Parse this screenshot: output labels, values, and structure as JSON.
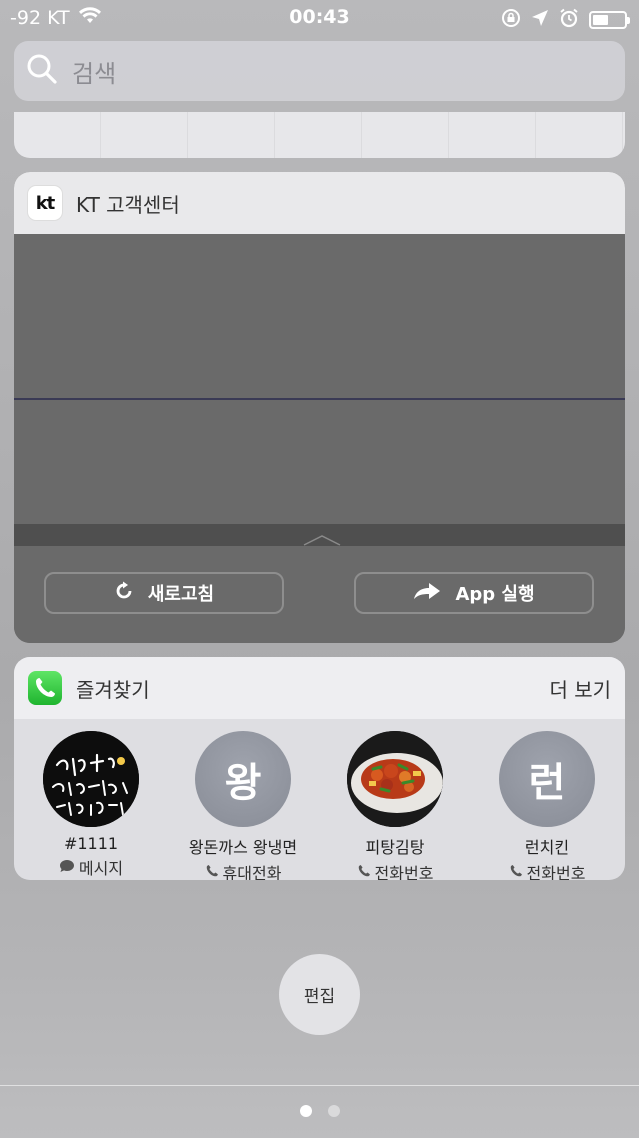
{
  "status_bar": {
    "carrier": "-92 KT",
    "time": "00:43",
    "battery_level": 0.5
  },
  "search": {
    "placeholder": "검색"
  },
  "kt_widget": {
    "title": "KT 고객센터",
    "logo_text": "kt",
    "refresh_label": "새로고침",
    "open_app_label": "App 실행"
  },
  "favorites_widget": {
    "title": "즐겨찾기",
    "more_label": "더 보기",
    "contacts": [
      {
        "name": "#1111",
        "type": "메시지",
        "type_icon": "message-bubble-icon",
        "avatar": "photo"
      },
      {
        "name": "왕돈까스 왕냉면",
        "type": "휴대전화",
        "type_icon": "phone-handset-icon",
        "avatar_letter": "왕"
      },
      {
        "name": "피탕김탕",
        "type": "전화번호",
        "type_icon": "phone-handset-icon",
        "avatar": "photo"
      },
      {
        "name": "런치킨",
        "type": "전화번호",
        "type_icon": "phone-handset-icon",
        "avatar_letter": "런"
      }
    ]
  },
  "edit_button": {
    "label": "편집"
  },
  "page_dots": {
    "count": 2,
    "active_index": 0
  }
}
